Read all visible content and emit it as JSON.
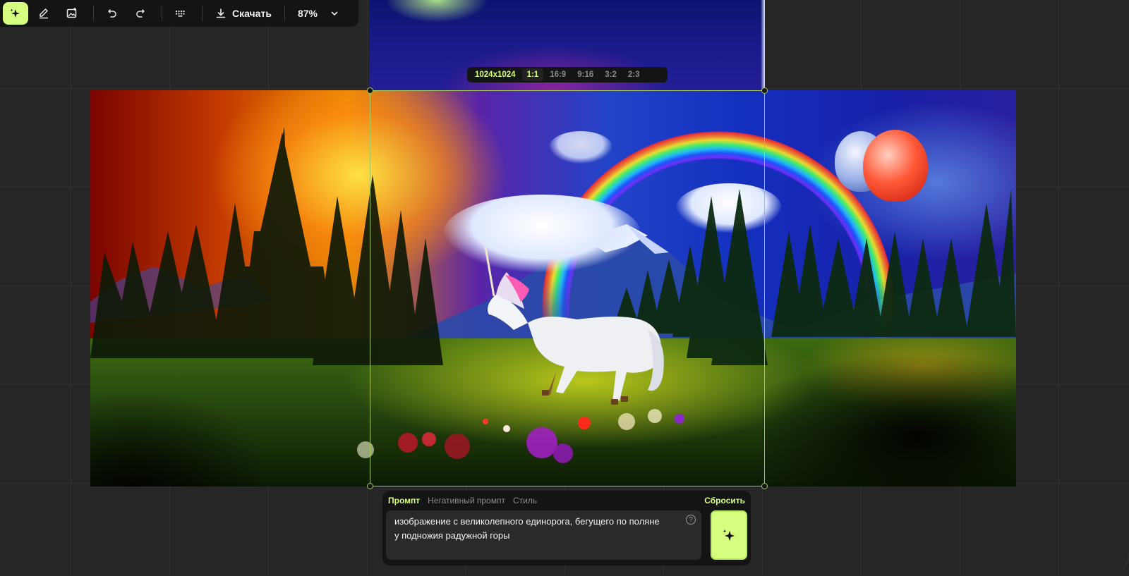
{
  "toolbar": {
    "tools": [
      {
        "icon": "sparkle-icon",
        "active": true
      },
      {
        "icon": "eraser-pencil-icon",
        "active": false
      },
      {
        "icon": "image-add-icon",
        "active": false
      }
    ],
    "undo_icon": "undo-icon",
    "redo_icon": "redo-icon",
    "shortcuts_icon": "keyboard-icon",
    "download_label": "Скачать",
    "zoom_label": "87%"
  },
  "ratio_bar": {
    "size": "1024x1024",
    "options": [
      "1:1",
      "16:9",
      "9:16",
      "3:2",
      "2:3"
    ],
    "selected": "1:1"
  },
  "prompt_panel": {
    "tabs": [
      "Промпт",
      "Негативный промпт",
      "Стиль"
    ],
    "active_tab": "Промпт",
    "reset_label": "Сбросить",
    "prompt_line1": "изображение с великолепного единорога, бегущего по поляне",
    "prompt_line2": "у подножия радужной горы",
    "help_glyph": "?",
    "generate_icon": "sparkle-icon"
  },
  "colors": {
    "accent": "#d6ff7f",
    "panel": "#141414",
    "canvas": "#262626",
    "frame": "#a6c85c"
  }
}
